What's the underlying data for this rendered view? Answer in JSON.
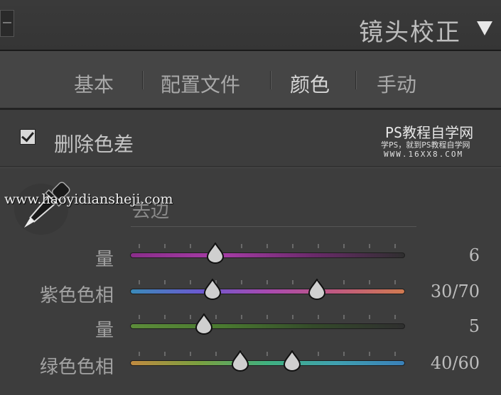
{
  "panel": {
    "title": "镜头校正"
  },
  "tabs": [
    {
      "label": "基本",
      "active": false
    },
    {
      "label": "配置文件",
      "active": false
    },
    {
      "label": "颜色",
      "active": true
    },
    {
      "label": "手动",
      "active": false
    }
  ],
  "chromatic": {
    "label": "删除色差",
    "checked": true
  },
  "watermark": {
    "title": "PS教程自学网",
    "subtitle": "学PS，就到PS教程自学网",
    "url": "WWW.16XX8.COM",
    "overlay_url": "www.haoyidiansheji.com"
  },
  "defringe": {
    "label": "去边"
  },
  "sliders": [
    {
      "label": "量",
      "value_text": "6",
      "positions": [
        0.31
      ],
      "gradient": [
        "#8a2e8a",
        "#a63ca6",
        "#6a2a6a",
        "#2f2f2f"
      ]
    },
    {
      "label": "紫色色相",
      "value_text": "30/70",
      "positions": [
        0.3,
        0.68
      ],
      "gradient": [
        "#3a8ab8",
        "#6a5ad0",
        "#a84ab0",
        "#c05a80",
        "#d07a50"
      ]
    },
    {
      "label": "量",
      "value_text": "5",
      "positions": [
        0.27
      ],
      "gradient": [
        "#5c8c3a",
        "#4a7a30",
        "#344a2a",
        "#2f2f2f"
      ]
    },
    {
      "label": "绿色色相",
      "value_text": "40/60",
      "positions": [
        0.4,
        0.59
      ],
      "gradient": [
        "#c08a40",
        "#7aa040",
        "#40b080",
        "#40a0b0",
        "#3a80b8"
      ]
    }
  ]
}
